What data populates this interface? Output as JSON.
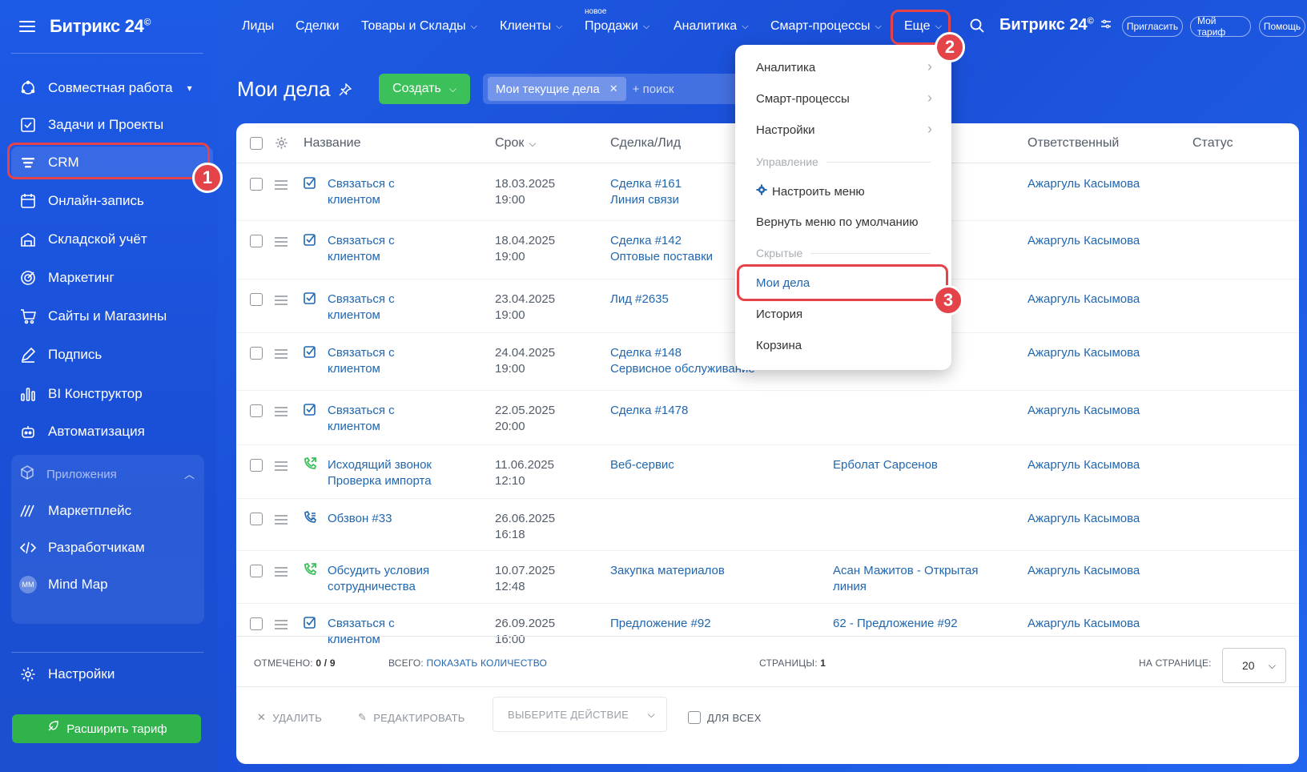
{
  "sidebar": {
    "brand": "Битрикс 24",
    "brand_mark": "©",
    "items": [
      {
        "label": "Совместная работа",
        "icon": "collab-icon"
      },
      {
        "label": "Задачи и Проекты",
        "icon": "tasks-icon"
      },
      {
        "label": "CRM",
        "icon": "crm-icon"
      },
      {
        "label": "Онлайн-запись",
        "icon": "calendar-icon"
      },
      {
        "label": "Складской учёт",
        "icon": "warehouse-icon"
      },
      {
        "label": "Маркетинг",
        "icon": "marketing-icon"
      },
      {
        "label": "Сайты и Магазины",
        "icon": "cart-icon"
      },
      {
        "label": "Подпись",
        "icon": "signature-icon"
      },
      {
        "label": "BI Конструктор",
        "icon": "chart-icon"
      },
      {
        "label": "Автоматизация",
        "icon": "robot-icon"
      }
    ],
    "apps_title": "Приложения",
    "apps": [
      {
        "label": "Маркетплейс",
        "icon": "marketplace-icon"
      },
      {
        "label": "Разработчикам",
        "icon": "code-icon"
      },
      {
        "label": "Mind Map",
        "icon": "mindmap-icon",
        "avatar": "MM"
      }
    ],
    "settings_label": "Настройки",
    "upgrade_label": "Расширить тариф"
  },
  "topnav": {
    "items": [
      "Лиды",
      "Сделки",
      "Товары и Склады",
      "Клиенты",
      "Продажи",
      "Аналитика",
      "Смарт-процессы",
      "Еще"
    ],
    "new_badge": "новое",
    "brand": "Битрикс 24",
    "brand_mark": "©",
    "invite": "Пригласить",
    "tariff": "Мой тариф",
    "help": "Помощь"
  },
  "header": {
    "title": "Мои дела",
    "create_label": "Создать",
    "filter_chip": "Мои текущие дела",
    "search_placeholder": "+ поиск"
  },
  "table": {
    "columns": [
      "Название",
      "Срок",
      "Сделка/Лид",
      "Ответственный",
      "Статус"
    ],
    "rows": [
      {
        "name": [
          "Связаться с",
          "клиентом"
        ],
        "type": "task",
        "date": "18.03.2025",
        "time": "19:00",
        "deal": [
          "Сделка #161",
          "Линия связи"
        ],
        "contact": "",
        "owner": "Ажаргуль Касымова"
      },
      {
        "name": [
          "Связаться с",
          "клиентом"
        ],
        "type": "task",
        "date": "18.04.2025",
        "time": "19:00",
        "deal": [
          "Сделка #142",
          "Оптовые поставки"
        ],
        "contact": "",
        "owner": "Ажаргуль Касымова"
      },
      {
        "name": [
          "Связаться с",
          "клиентом"
        ],
        "type": "task",
        "date": "23.04.2025",
        "time": "19:00",
        "deal": [
          "Лид #2635",
          ""
        ],
        "contact": "",
        "owner": "Ажаргуль Касымова"
      },
      {
        "name": [
          "Связаться с",
          "клиентом"
        ],
        "type": "task",
        "date": "24.04.2025",
        "time": "19:00",
        "deal": [
          "Сделка #148",
          "Сервисное обслуживание"
        ],
        "contact": "",
        "owner": "Ажаргуль Касымова"
      },
      {
        "name": [
          "Связаться с",
          "клиентом"
        ],
        "type": "task",
        "date": "22.05.2025",
        "time": "20:00",
        "deal": [
          "Сделка #1478",
          ""
        ],
        "contact": "",
        "owner": "Ажаргуль Касымова"
      },
      {
        "name": [
          "Исходящий звонок",
          "Проверка импорта"
        ],
        "type": "call",
        "date": "11.06.2025",
        "time": "12:10",
        "deal": [
          "Веб-сервис",
          ""
        ],
        "contact": "Ерболат Сарсенов",
        "owner": "Ажаргуль Касымова"
      },
      {
        "name": [
          "Обзвон #33",
          ""
        ],
        "type": "dial",
        "date": "26.06.2025",
        "time": "16:18",
        "deal": [
          "",
          ""
        ],
        "contact": "",
        "owner": "Ажаргуль Касымова"
      },
      {
        "name": [
          "Обсудить условия",
          "сотрудничества"
        ],
        "type": "call",
        "date": "10.07.2025",
        "time": "12:48",
        "deal": [
          "Закупка материалов",
          ""
        ],
        "contact": "Асан Мажитов - Открытая линия",
        "owner": "Ажаргуль Касымова"
      },
      {
        "name": [
          "Связаться с",
          "клиентом"
        ],
        "type": "task",
        "date": "26.09.2025",
        "time": "16:00",
        "deal": [
          "Предложение #92",
          ""
        ],
        "contact": "62 - Предложение #92",
        "owner": "Ажаргуль Касымова"
      }
    ]
  },
  "footer": {
    "checked_label": "ОТМЕЧЕНО:",
    "checked_value": "0 / 9",
    "total_label": "ВСЕГО:",
    "total_link": "ПОКАЗАТЬ КОЛИЧЕСТВО",
    "pages_label": "СТРАНИЦЫ:",
    "pages_value": "1",
    "per_page_label": "НА СТРАНИЦЕ:",
    "per_page_value": "20",
    "delete": "УДАЛИТЬ",
    "edit": "РЕДАКТИРОВАТЬ",
    "select_action": "ВЫБЕРИТЕ ДЕЙСТВИЕ",
    "for_all": "ДЛЯ ВСЕХ"
  },
  "dropdown": {
    "items": [
      {
        "label": "Аналитика",
        "arrow": true
      },
      {
        "label": "Смарт-процессы",
        "arrow": true
      },
      {
        "label": "Настройки",
        "arrow": true
      }
    ],
    "group_manage": "Управление",
    "configure_menu": "Настроить меню",
    "reset_menu": "Вернуть меню по умолчанию",
    "group_hidden": "Скрытые",
    "my_tasks": "Мои дела",
    "history": "История",
    "trash": "Корзина"
  },
  "badges": [
    "1",
    "2",
    "3"
  ],
  "colors": {
    "accent": "#1d5ae6",
    "green": "#3bc05a",
    "link": "#2067b0",
    "highlight": "#e4434a"
  }
}
